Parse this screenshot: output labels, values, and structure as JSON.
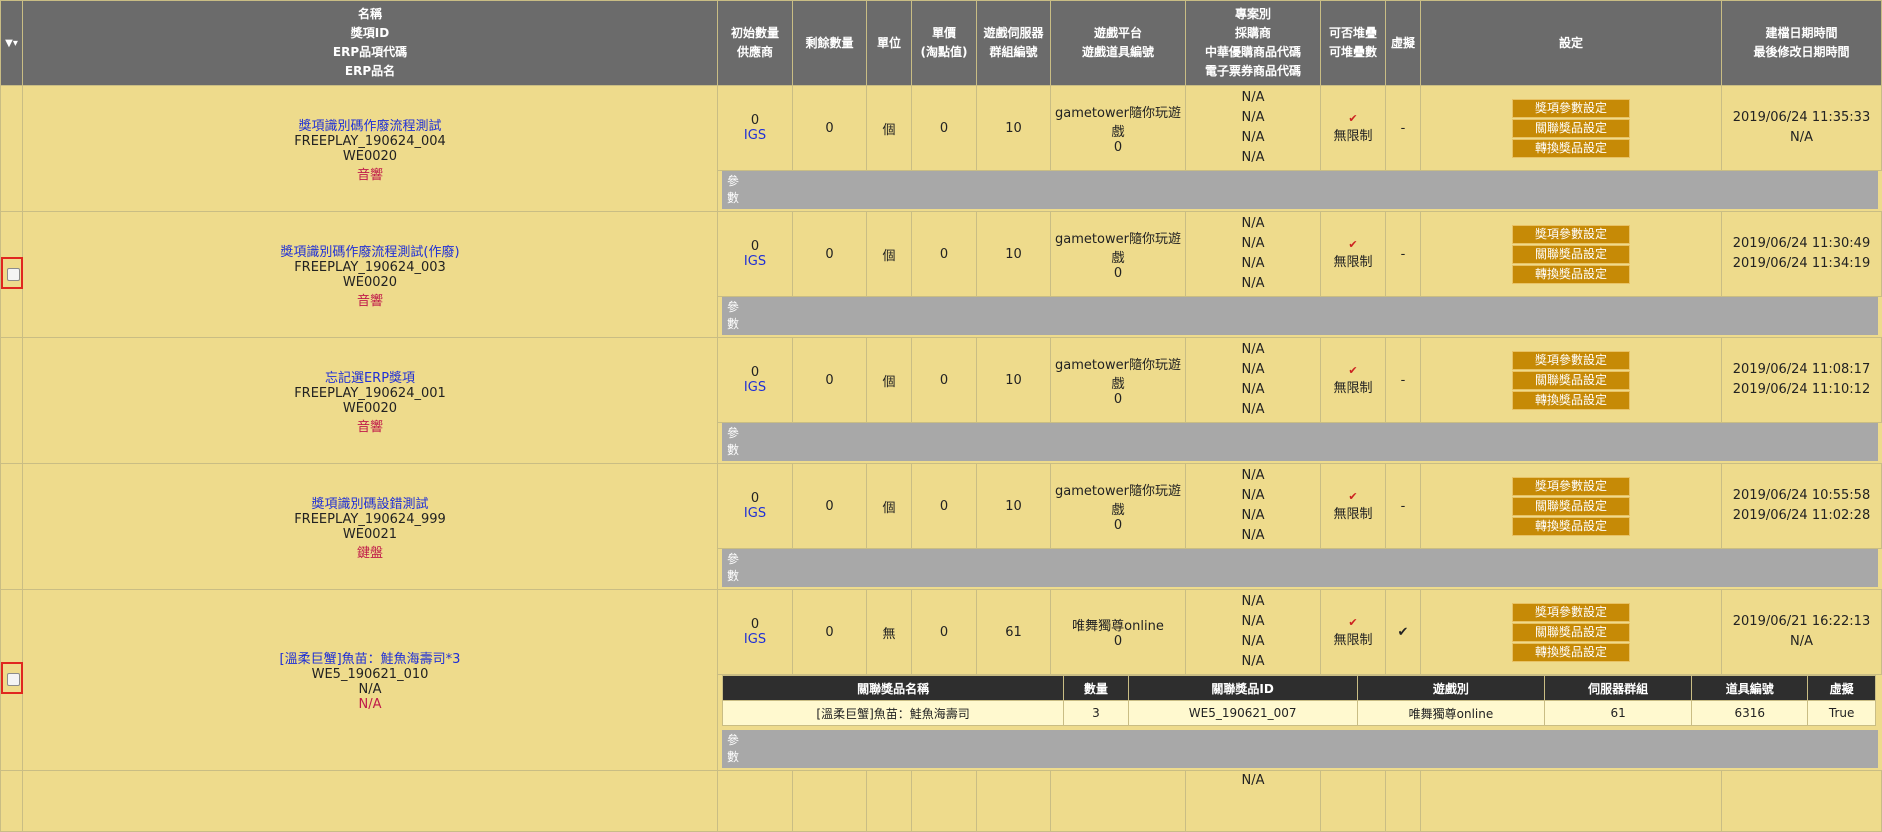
{
  "header": {
    "sort_icon": "▼▾",
    "col_name_lines": [
      "名稱",
      "獎項ID",
      "ERP品項代碼",
      "ERP品名"
    ],
    "col_initial_qty_lines": [
      "初始數量",
      "供應商"
    ],
    "col_remaining_qty": "剩餘數量",
    "col_unit": "單位",
    "col_price_lines": [
      "單價",
      "(淘點值)"
    ],
    "col_server_group_lines": [
      "遊戲伺服器",
      "群組編號"
    ],
    "col_platform_lines": [
      "遊戲平台",
      "遊戲道具編號"
    ],
    "col_project_lines": [
      "專案別",
      "採購商",
      "中華優購商品代碼",
      "電子票券商品代碼"
    ],
    "col_stackable_lines": [
      "可否堆疊",
      "可堆疊數"
    ],
    "col_virtual": "虛擬",
    "col_settings": "設定",
    "col_datetime_lines": [
      "建檔日期時間",
      "最後修改日期時間"
    ]
  },
  "buttons": {
    "award_params": "獎項參數設定",
    "related_prizes": "關聯獎品設定",
    "convert_prizes": "轉換獎品設定"
  },
  "param_label": [
    "參",
    "數"
  ],
  "rows": [
    {
      "checkbox": false,
      "name": "獎項識別碼作廢流程測試",
      "award_id": "FREEPLAY_190624_004",
      "erp_code": "WE0020",
      "erp_name": "音響",
      "initial_qty": "0",
      "supplier": "IGS",
      "remaining": "0",
      "unit": "個",
      "price": "0",
      "server_group": "10",
      "platform": "gametower隨你玩遊戲",
      "item_no": "0",
      "project": [
        "N/A",
        "N/A",
        "N/A",
        "N/A"
      ],
      "stackable": "✔",
      "stack_count": "無限制",
      "virtual": "-",
      "created": "2019/06/24 11:35:33",
      "modified": "N/A"
    },
    {
      "checkbox": true,
      "name": "獎項識別碼作廢流程測試(作廢)",
      "award_id": "FREEPLAY_190624_003",
      "erp_code": "WE0020",
      "erp_name": "音響",
      "initial_qty": "0",
      "supplier": "IGS",
      "remaining": "0",
      "unit": "個",
      "price": "0",
      "server_group": "10",
      "platform": "gametower隨你玩遊戲",
      "item_no": "0",
      "project": [
        "N/A",
        "N/A",
        "N/A",
        "N/A"
      ],
      "stackable": "✔",
      "stack_count": "無限制",
      "virtual": "-",
      "created": "2019/06/24 11:30:49",
      "modified": "2019/06/24 11:34:19"
    },
    {
      "checkbox": false,
      "name": "忘記選ERP獎項",
      "award_id": "FREEPLAY_190624_001",
      "erp_code": "WE0020",
      "erp_name": "音響",
      "initial_qty": "0",
      "supplier": "IGS",
      "remaining": "0",
      "unit": "個",
      "price": "0",
      "server_group": "10",
      "platform": "gametower隨你玩遊戲",
      "item_no": "0",
      "project": [
        "N/A",
        "N/A",
        "N/A",
        "N/A"
      ],
      "stackable": "✔",
      "stack_count": "無限制",
      "virtual": "-",
      "created": "2019/06/24 11:08:17",
      "modified": "2019/06/24 11:10:12"
    },
    {
      "checkbox": false,
      "name": "獎項識別碼設錯測試",
      "award_id": "FREEPLAY_190624_999",
      "erp_code": "WE0021",
      "erp_name": "鍵盤",
      "initial_qty": "0",
      "supplier": "IGS",
      "remaining": "0",
      "unit": "個",
      "price": "0",
      "server_group": "10",
      "platform": "gametower隨你玩遊戲",
      "item_no": "0",
      "project": [
        "N/A",
        "N/A",
        "N/A",
        "N/A"
      ],
      "stackable": "✔",
      "stack_count": "無限制",
      "virtual": "-",
      "created": "2019/06/24 10:55:58",
      "modified": "2019/06/24 11:02:28"
    },
    {
      "checkbox": true,
      "name": "[溫柔巨蟹]魚苗：鮭魚海壽司*3",
      "award_id": "WE5_190621_010",
      "erp_code": "N/A",
      "erp_name": "N/A",
      "initial_qty": "0",
      "supplier": "IGS",
      "remaining": "0",
      "unit": "無",
      "price": "0",
      "server_group": "61",
      "platform": "唯舞獨尊online",
      "item_no": "0",
      "project": [
        "N/A",
        "N/A",
        "N/A",
        "N/A"
      ],
      "stackable": "✔",
      "stack_count": "無限制",
      "virtual": "✔",
      "created": "2019/06/21 16:22:13",
      "modified": "N/A"
    }
  ],
  "related_table": {
    "headers": [
      "關聯獎品名稱",
      "數量",
      "關聯獎品ID",
      "遊戲別",
      "伺服器群組",
      "道具編號",
      "虛擬"
    ],
    "rows": [
      [
        "[溫柔巨蟹]魚苗：鮭魚海壽司",
        "3",
        "WE5_190621_007",
        "唯舞獨尊online",
        "61",
        "6316",
        "True"
      ]
    ]
  },
  "partial_row": {
    "project_first": "N/A"
  }
}
